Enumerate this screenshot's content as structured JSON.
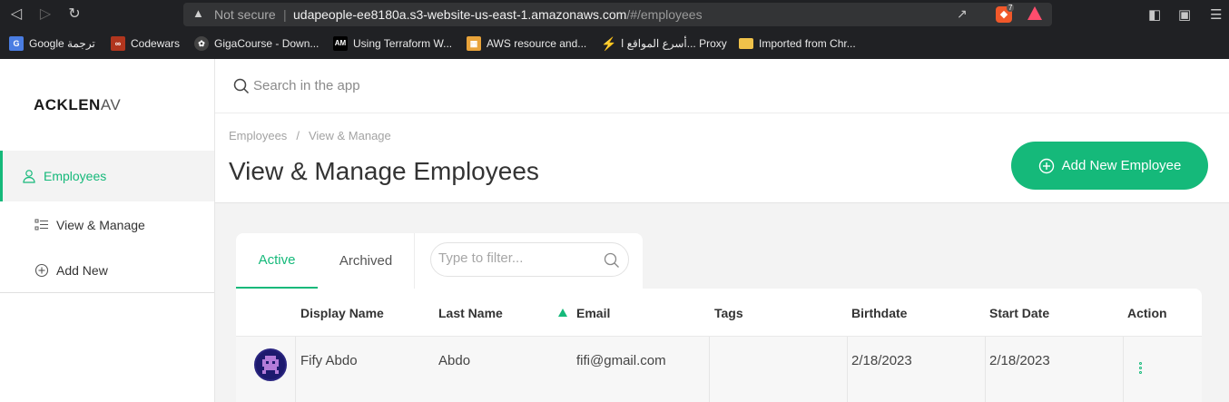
{
  "browser": {
    "security_label": "Not secure",
    "host": "udapeople-ee8180a.s3-website-us-east-1.amazonaws.com",
    "path": "/#/employees",
    "brave_badge": "7",
    "bookmarks": [
      {
        "label": "Google ترجمة",
        "icon": "google-translate-icon"
      },
      {
        "label": "Codewars",
        "icon": "codewars-icon"
      },
      {
        "label": "GigaCourse - Down...",
        "icon": "gigacourse-icon"
      },
      {
        "label": "Using Terraform W...",
        "icon": "am-icon"
      },
      {
        "label": "AWS resource and...",
        "icon": "aws-icon"
      },
      {
        "label": "أسرع المواقع ا... Proxy",
        "icon": "lightning-icon"
      },
      {
        "label": "Imported from Chr...",
        "icon": "folder-icon"
      }
    ]
  },
  "sidebar": {
    "logo_bold": "ACKLEN",
    "logo_thin": "AV",
    "items": [
      {
        "label": "Employees",
        "icon": "user-icon"
      },
      {
        "label": "View & Manage",
        "icon": "list-icon"
      },
      {
        "label": "Add New",
        "icon": "plus-circle-icon"
      }
    ]
  },
  "search": {
    "placeholder": "Search in the app"
  },
  "header": {
    "breadcrumb": [
      "Employees",
      "View & Manage"
    ],
    "breadcrumb_separator": "/",
    "title": "View & Manage Employees",
    "add_button_label": "Add New Employee"
  },
  "tabs": [
    {
      "label": "Active",
      "active": true
    },
    {
      "label": "Archived",
      "active": false
    }
  ],
  "filter": {
    "placeholder": "Type to filter..."
  },
  "table": {
    "columns": [
      "Display Name",
      "Last Name",
      "Email",
      "Tags",
      "Birthdate",
      "Start Date",
      "Action"
    ],
    "sorted_column": "Email",
    "rows": [
      {
        "display_name": "Fify Abdo",
        "last_name": "Abdo",
        "email": "fifi@gmail.com",
        "tags": "",
        "birthdate": "2/18/2023",
        "start_date": "2/18/2023"
      }
    ]
  },
  "colors": {
    "accent": "#15b97a",
    "chrome": "#202124"
  }
}
